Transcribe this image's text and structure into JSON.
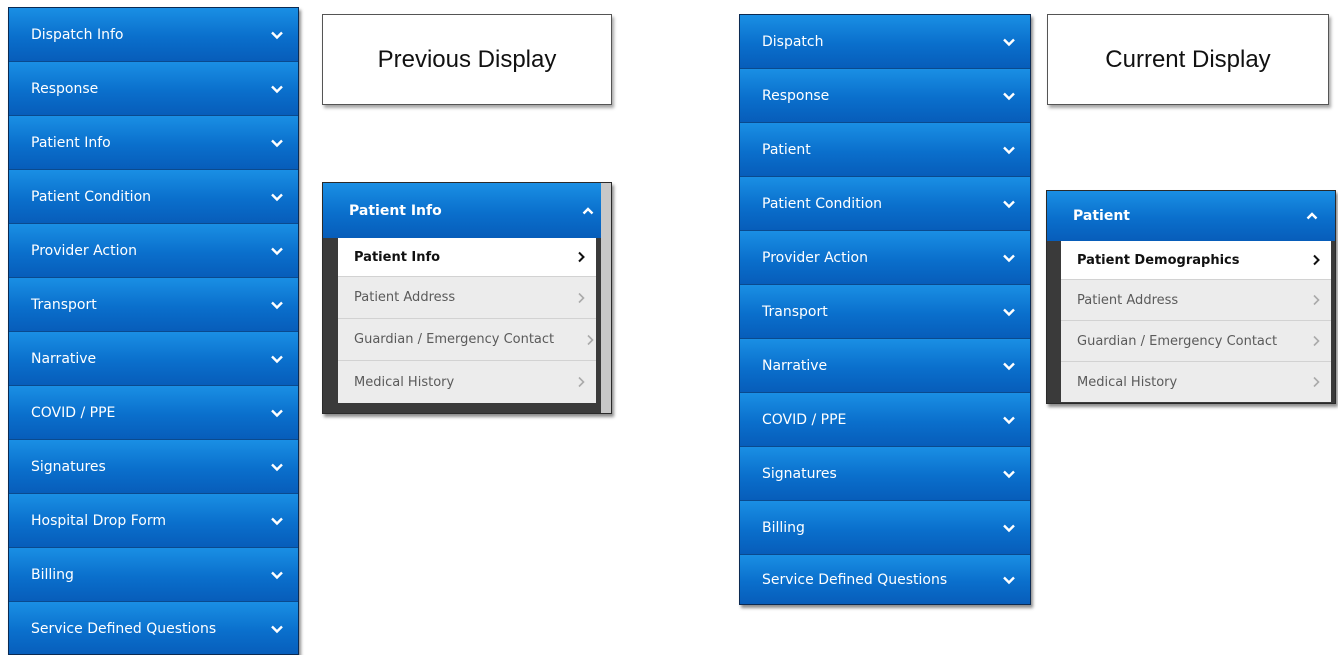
{
  "previous": {
    "title": "Previous Display",
    "menu_items": [
      {
        "label": "Dispatch Info"
      },
      {
        "label": "Response"
      },
      {
        "label": "Patient Info"
      },
      {
        "label": "Patient Condition"
      },
      {
        "label": "Provider Action"
      },
      {
        "label": "Transport"
      },
      {
        "label": "Narrative"
      },
      {
        "label": "COVID / PPE"
      },
      {
        "label": "Signatures"
      },
      {
        "label": "Hospital Drop Form"
      },
      {
        "label": "Billing"
      },
      {
        "label": "Service Defined Questions"
      }
    ],
    "panel": {
      "header": "Patient Info",
      "items": [
        {
          "label": "Patient Info",
          "active": true
        },
        {
          "label": "Patient Address"
        },
        {
          "label": "Guardian / Emergency Contact"
        },
        {
          "label": "Medical History"
        }
      ]
    }
  },
  "current": {
    "title": "Current Display",
    "menu_items": [
      {
        "label": "Dispatch"
      },
      {
        "label": "Response"
      },
      {
        "label": "Patient"
      },
      {
        "label": "Patient Condition"
      },
      {
        "label": "Provider Action"
      },
      {
        "label": "Transport"
      },
      {
        "label": "Narrative"
      },
      {
        "label": "COVID / PPE"
      },
      {
        "label": "Signatures"
      },
      {
        "label": "Billing"
      },
      {
        "label": "Service Defined Questions"
      }
    ],
    "panel": {
      "header": "Patient",
      "items": [
        {
          "label": "Patient Demographics",
          "active": true
        },
        {
          "label": "Patient Address"
        },
        {
          "label": "Guardian / Emergency Contact"
        },
        {
          "label": "Medical History"
        }
      ]
    }
  },
  "icons": {
    "collapsed": "chevron-down-icon",
    "expanded": "chevron-up-icon",
    "submenu": "chevron-right-icon"
  }
}
